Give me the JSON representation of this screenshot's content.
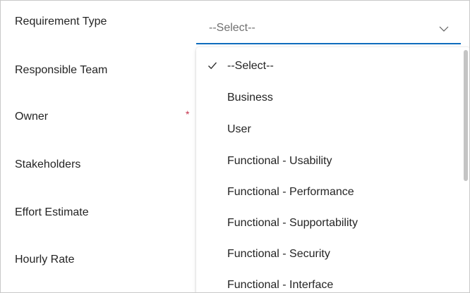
{
  "form": {
    "fields": [
      {
        "label": "Requirement Type"
      },
      {
        "label": "Responsible Team"
      },
      {
        "label": "Owner",
        "required_marker": "*"
      },
      {
        "label": "Stakeholders"
      },
      {
        "label": "Effort Estimate"
      },
      {
        "label": "Hourly Rate"
      }
    ]
  },
  "select": {
    "value": "--Select--",
    "icon": "chevron-down-icon",
    "options": [
      {
        "label": "--Select--",
        "selected": true
      },
      {
        "label": "Business"
      },
      {
        "label": "User"
      },
      {
        "label": "Functional - Usability"
      },
      {
        "label": "Functional - Performance"
      },
      {
        "label": "Functional - Supportability"
      },
      {
        "label": "Functional - Security"
      },
      {
        "label": "Functional - Interface"
      }
    ],
    "selected_icon": "checkmark-icon"
  },
  "colors": {
    "accent": "#0f6cbd",
    "required": "#c4314b",
    "text": "#242424",
    "placeholder": "#6f6f6f"
  }
}
